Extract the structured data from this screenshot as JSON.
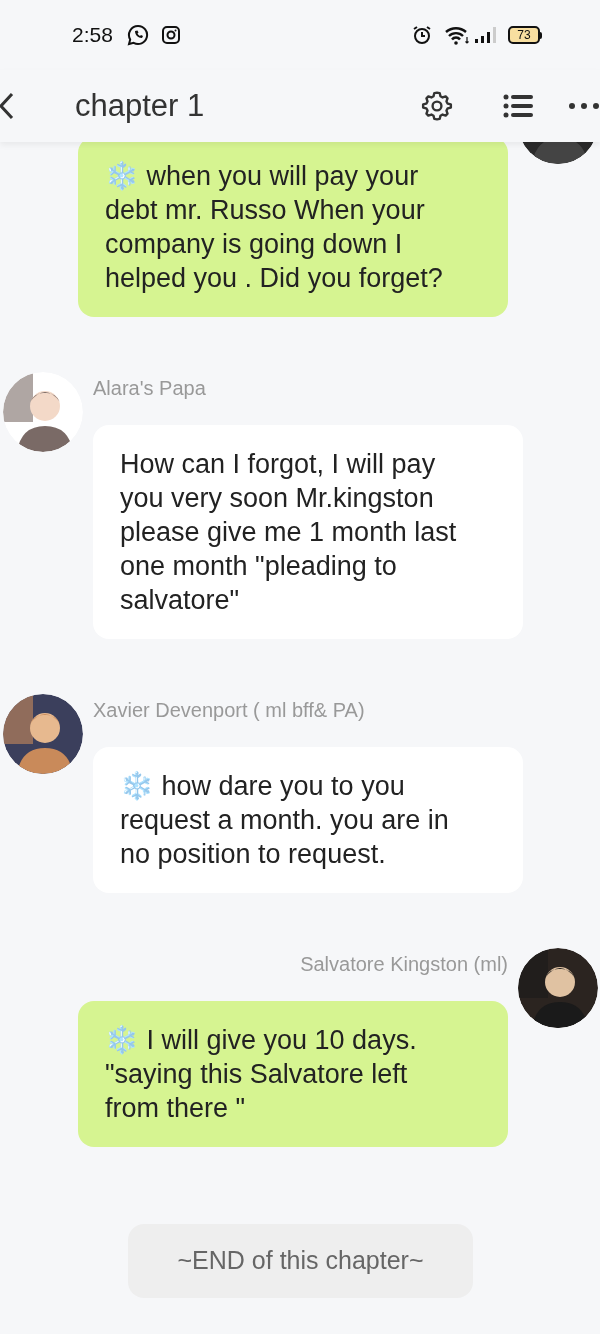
{
  "status_bar": {
    "time": "2:58",
    "battery": "73"
  },
  "header": {
    "title": "chapter 1"
  },
  "messages": [
    {
      "outgoing": true,
      "text": "❄️ when you will pay your debt mr. Russo When your company is going down I helped you .  Did you forget?"
    },
    {
      "outgoing": false,
      "sender": "Alara's Papa",
      "text": "How can I forgot, I will pay you very soon Mr.kingston please give me 1 month last one month \"pleading to salvatore\""
    },
    {
      "outgoing": false,
      "sender": "Xavier Devenport ( ml bff& PA)",
      "text": "❄️ how dare you to you request a month. you are in no position to request."
    },
    {
      "outgoing": true,
      "sender": "Salvatore Kingston (ml)",
      "text": "❄️ I will give you 10 days. \"saying this Salvatore left from there \""
    }
  ],
  "end_label": "~END of this chapter~"
}
